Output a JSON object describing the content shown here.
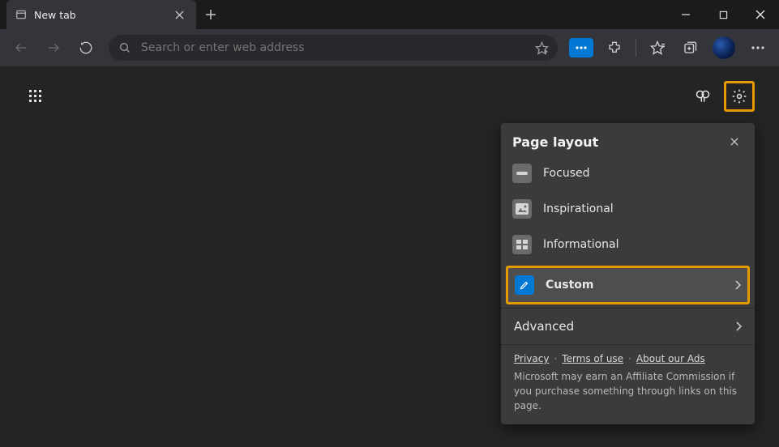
{
  "tab": {
    "title": "New tab"
  },
  "addressbar": {
    "placeholder": "Search or enter web address"
  },
  "flyout": {
    "title": "Page layout",
    "options": {
      "focused": "Focused",
      "inspirational": "Inspirational",
      "informational": "Informational",
      "custom": "Custom"
    },
    "advanced": "Advanced",
    "links": {
      "privacy": "Privacy",
      "terms": "Terms of use",
      "ads": "About our Ads"
    },
    "disclaimer": "Microsoft may earn an Affiliate Commission if you purchase something through links on this page."
  }
}
